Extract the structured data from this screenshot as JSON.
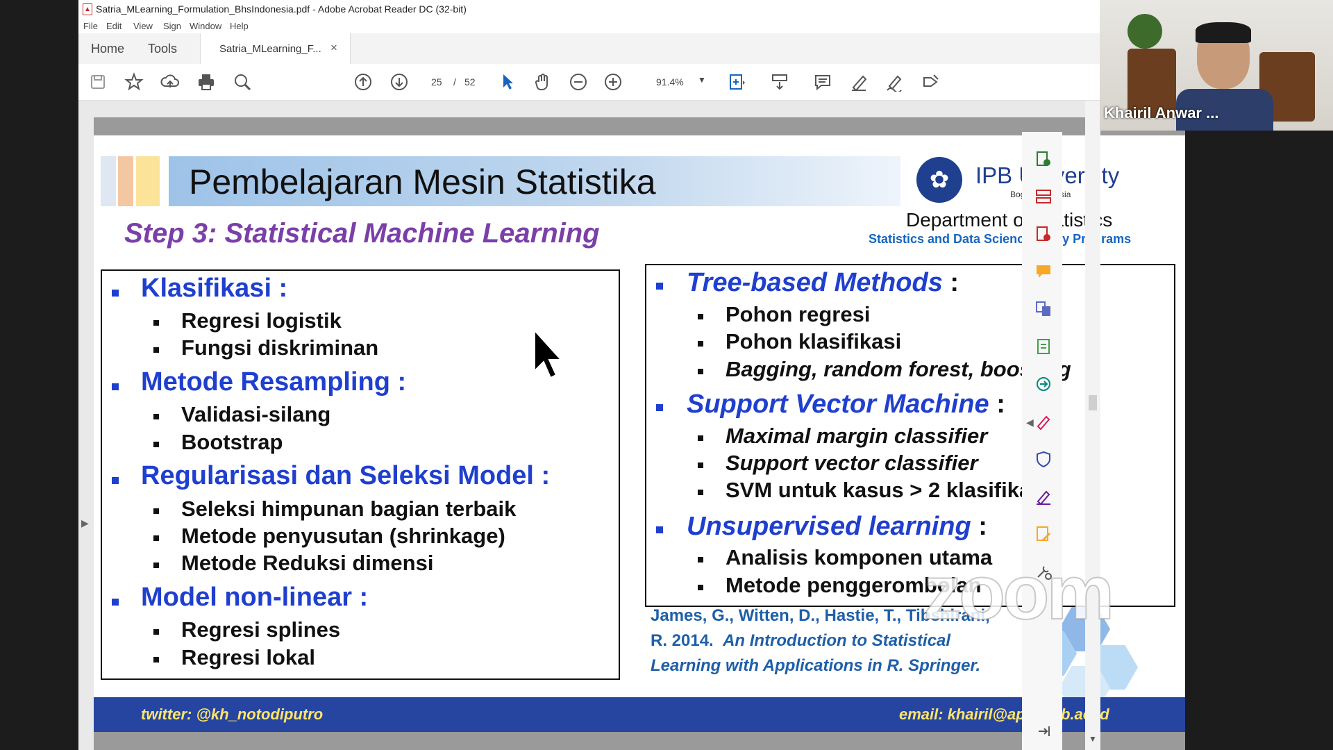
{
  "window": {
    "title": "Satria_MLearning_Formulation_BhsIndonesia.pdf - Adobe Acrobat Reader DC (32-bit)"
  },
  "menu": [
    "File",
    "Edit",
    "View",
    "Sign",
    "Window",
    "Help"
  ],
  "tabs": {
    "home": "Home",
    "tools": "Tools",
    "doc": "Satria_MLearning_F...",
    "close": "×"
  },
  "toolbar": {
    "page_current": "25",
    "page_sep": "/",
    "page_total": "52",
    "zoom": "91.4%"
  },
  "slide": {
    "title": "Pembelajaran Mesin Statistika",
    "step": "Step 3: Statistical Machine Learning",
    "logo": {
      "name": "IPB University",
      "sub": "Bogor Indonesia"
    },
    "dept": "Department of Statistics",
    "program": "Statistics and Data Science Study Programs",
    "left": [
      {
        "head": "Klasifikasi :",
        "items": [
          "Regresi logistik",
          "Fungsi diskriminan"
        ]
      },
      {
        "head": "Metode Resampling :",
        "items": [
          "Validasi-silang",
          "Bootstrap"
        ]
      },
      {
        "head": "Regularisasi dan Seleksi Model :",
        "items": [
          "Seleksi himpunan bagian terbaik",
          "Metode penyusutan (shrinkage)",
          "Metode Reduksi dimensi"
        ]
      },
      {
        "head": "Model non-linear :",
        "items": [
          "Regresi splines",
          "Regresi lokal"
        ]
      }
    ],
    "right": [
      {
        "head": "Tree-based Methods",
        "colon": ":",
        "items": [
          "Pohon regresi",
          "Pohon klasifikasi",
          "Bagging, random forest, boosting"
        ]
      },
      {
        "head": "Support Vector Machine",
        "colon": ":",
        "items": [
          "Maximal margin classifier",
          "Support vector classifier",
          "SVM untuk kasus > 2 klasifikasi"
        ]
      },
      {
        "head": "Unsupervised learning",
        "colon": ":",
        "items": [
          "Analisis komponen utama",
          "Metode penggerombolan"
        ]
      }
    ],
    "reference": {
      "line1": "James, G., Witten, D., Hastie, T., Tibshirani,",
      "line2_plain": "R. 2014.",
      "line2_italic": "An Introduction to Statistical",
      "line3": "Learning with Applications in R. Springer."
    },
    "footer": {
      "twitter": "twitter:  @kh_notodiputro",
      "email": "email:  khairil@apps.ipb.ac.id"
    }
  },
  "video": {
    "name": "Khairil Anwar ..."
  },
  "watermark": "zoom",
  "colors": {
    "heading_blue": "#1f3fcf",
    "step_purple": "#7b3fa8",
    "footer_blue": "#2545a0",
    "footer_text": "#ffe56b"
  }
}
